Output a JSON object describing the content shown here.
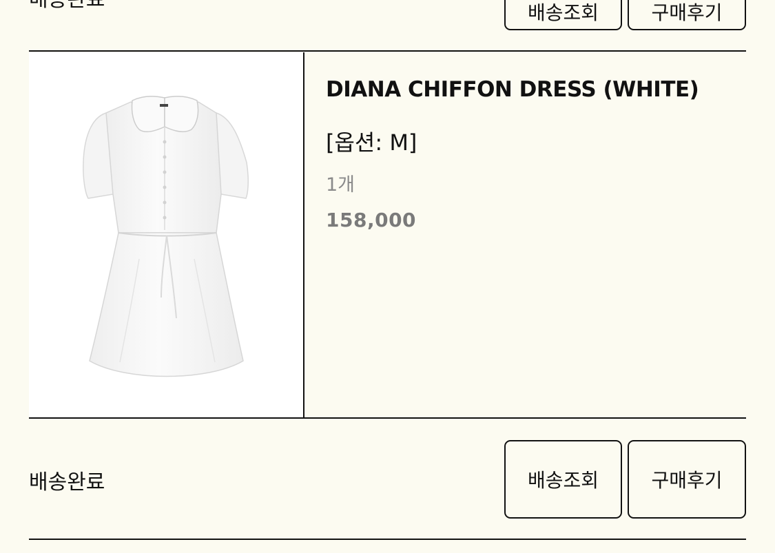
{
  "previous_order": {
    "status": "배송완료",
    "buttons": {
      "track_label": "배송조회",
      "review_label": "구매후기"
    }
  },
  "order_item": {
    "product": {
      "name": "DIANA CHIFFON DRESS (WHITE)",
      "option": "[옵션: M]",
      "quantity": "1개",
      "price": "158,000",
      "image_alt": "DIANA CHIFFON DRESS (WHITE)"
    },
    "status": "배송완료",
    "buttons": {
      "track_label": "배송조회",
      "review_label": "구매후기"
    }
  }
}
